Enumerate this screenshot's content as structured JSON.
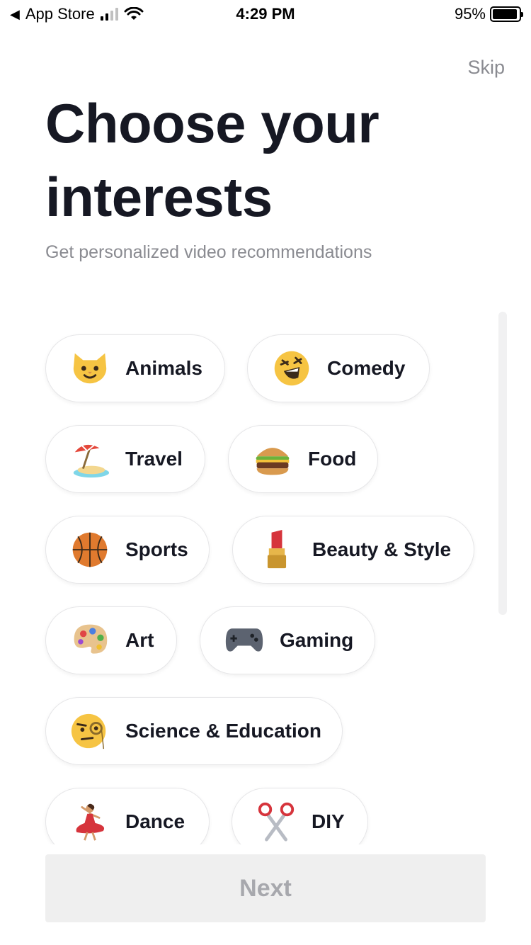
{
  "status_bar": {
    "back_label": "App Store",
    "time": "4:29 PM",
    "battery": "95%",
    "battery_level": 0.95
  },
  "header": {
    "skip_label": "Skip",
    "title": "Choose your interests",
    "subtitle": "Get personalized video recommendations"
  },
  "interests": [
    {
      "label": "Animals",
      "icon": "cat-face-icon"
    },
    {
      "label": "Comedy",
      "icon": "laughing-face-icon"
    },
    {
      "label": "Travel",
      "icon": "beach-umbrella-icon"
    },
    {
      "label": "Food",
      "icon": "burger-icon"
    },
    {
      "label": "Sports",
      "icon": "basketball-icon"
    },
    {
      "label": "Beauty & Style",
      "icon": "lipstick-icon"
    },
    {
      "label": "Art",
      "icon": "palette-icon"
    },
    {
      "label": "Gaming",
      "icon": "game-controller-icon"
    },
    {
      "label": "Science & Education",
      "icon": "monocle-face-icon"
    },
    {
      "label": "Dance",
      "icon": "dancer-icon"
    },
    {
      "label": "DIY",
      "icon": "scissors-icon"
    }
  ],
  "footer": {
    "next_label": "Next"
  },
  "colors": {
    "text": "#161823",
    "muted": "#8a8b91",
    "button_bg": "#efefef",
    "button_text": "#a7a8ad"
  }
}
